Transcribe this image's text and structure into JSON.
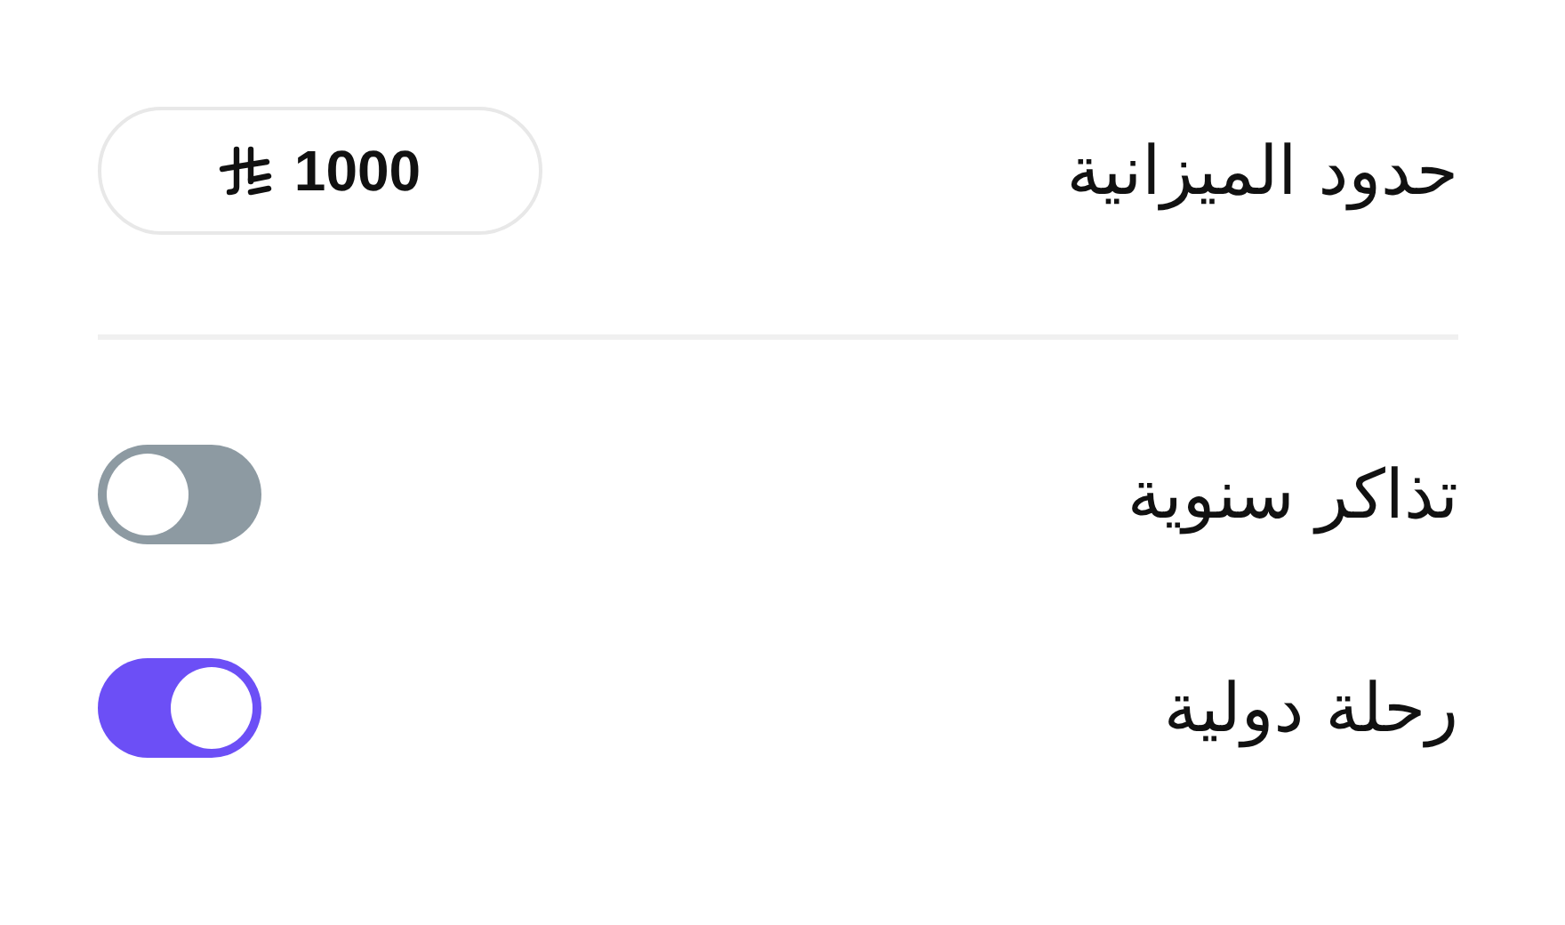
{
  "budget": {
    "label": "حدود الميزانية",
    "amount": "1000"
  },
  "toggles": [
    {
      "label": "تذاكر سنوية",
      "on": false
    },
    {
      "label": "رحلة دولية",
      "on": true
    }
  ]
}
